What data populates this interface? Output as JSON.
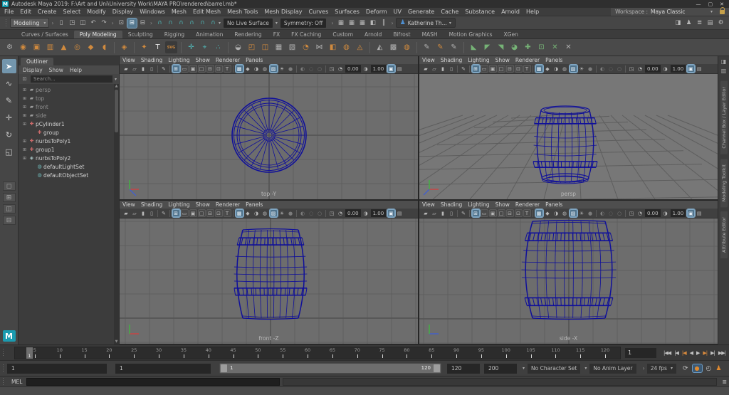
{
  "window": {
    "logo_glyph": "M",
    "title": "Autodesk Maya 2019: F:\\Art and Uni\\University Work\\MAYA PRO\\rendered\\barrel.mb*",
    "controls": {
      "minimize": "—",
      "maximize": "▢",
      "close": "✕"
    }
  },
  "menu_bar": {
    "items": [
      "File",
      "Edit",
      "Create",
      "Select",
      "Modify",
      "Display",
      "Windows",
      "Mesh",
      "Edit Mesh",
      "Mesh Tools",
      "Mesh Display",
      "Curves",
      "Surfaces",
      "Deform",
      "UV",
      "Generate",
      "Cache",
      "Substance",
      "Arnold",
      "Help"
    ],
    "workspace_label": "Workspace :",
    "workspace_value": "Maya Classic"
  },
  "status_line": {
    "mode": "Modeling",
    "file_icons": [
      {
        "name": "new-scene-icon",
        "glyph": "▯"
      },
      {
        "name": "open-scene-icon",
        "glyph": "◳"
      },
      {
        "name": "save-scene-icon",
        "glyph": "◫"
      },
      {
        "name": "undo-icon",
        "glyph": "↶"
      },
      {
        "name": "redo-icon",
        "glyph": "↷"
      }
    ],
    "selection_icons": [
      {
        "name": "select-hierarchy-icon",
        "glyph": "⊡"
      },
      {
        "name": "select-object-icon",
        "glyph": "⊞",
        "active": true
      },
      {
        "name": "select-component-icon",
        "glyph": "⊟"
      }
    ],
    "snap_icons": [
      {
        "name": "snap-grid-icon",
        "glyph": "∩"
      },
      {
        "name": "snap-curve-icon",
        "glyph": "∩"
      },
      {
        "name": "snap-point-icon",
        "glyph": "∩"
      },
      {
        "name": "snap-projected-center-icon",
        "glyph": "∩"
      },
      {
        "name": "snap-view-plane-icon",
        "glyph": "∩"
      },
      {
        "name": "snap-live-surface-icon",
        "glyph": "∩"
      }
    ],
    "live_surface": "No Live Surface",
    "symmetry": "Symmetry: Off",
    "render_icons": [
      {
        "name": "render-frame-icon",
        "glyph": "▦"
      },
      {
        "name": "ipr-render-icon",
        "glyph": "▦"
      },
      {
        "name": "render-settings-icon",
        "glyph": "▦"
      },
      {
        "name": "launch-render-view-icon",
        "glyph": "◧"
      },
      {
        "name": "pause-viewport-icon",
        "glyph": "‖"
      }
    ],
    "user": "Katherine Th...",
    "right_icons": [
      {
        "name": "show-attribute-editor-icon",
        "glyph": "◨"
      },
      {
        "name": "show-tool-settings-icon",
        "glyph": "♟"
      },
      {
        "name": "show-channel-box-icon",
        "glyph": "≣"
      },
      {
        "name": "show-layer-editor-icon",
        "glyph": "▤"
      },
      {
        "name": "show-modeling-toolkit-icon",
        "glyph": "⚙"
      }
    ]
  },
  "shelf": {
    "active_tab": "Poly Modeling",
    "tabs": [
      "Curves / Surfaces",
      "Poly Modeling",
      "Sculpting",
      "Rigging",
      "Animation",
      "Rendering",
      "FX",
      "FX Caching",
      "Custom",
      "Arnold",
      "Bifrost",
      "MASH",
      "Motion Graphics",
      "XGen"
    ],
    "icons": [
      {
        "name": "shelf-gear-icon",
        "glyph": "⚙",
        "color": "#b0b0b0"
      },
      {
        "name": "poly-sphere-icon",
        "glyph": "◉",
        "color": "#d08a3e"
      },
      {
        "name": "poly-cube-icon",
        "glyph": "▣",
        "color": "#d08a3e"
      },
      {
        "name": "poly-cylinder-icon",
        "glyph": "▥",
        "color": "#d08a3e"
      },
      {
        "name": "poly-cone-icon",
        "glyph": "▲",
        "color": "#d08a3e"
      },
      {
        "name": "poly-torus-icon",
        "glyph": "◎",
        "color": "#d08a3e"
      },
      {
        "name": "poly-plane-icon",
        "glyph": "◆",
        "color": "#d08a3e"
      },
      {
        "name": "poly-disc-icon",
        "glyph": "◖",
        "color": "#d08a3e"
      },
      {
        "name": "sep"
      },
      {
        "name": "platonic-solid-icon",
        "glyph": "◈",
        "color": "#d08a3e"
      },
      {
        "name": "sep"
      },
      {
        "name": "create-polygon-icon",
        "glyph": "✦",
        "color": "#d08a3e"
      },
      {
        "name": "type-tool-icon",
        "glyph": "T",
        "color": "#e2e2e2"
      },
      {
        "name": "svg-tool-icon",
        "glyph": "SVG",
        "color": "#d08a3e",
        "small": true
      },
      {
        "name": "sep"
      },
      {
        "name": "construction-plane-icon",
        "glyph": "✛",
        "color": "#52b8b8"
      },
      {
        "name": "locator-icon",
        "glyph": "⌖",
        "color": "#52b8b8"
      },
      {
        "name": "origin-locator-icon",
        "glyph": "∴",
        "color": "#52b8b8"
      },
      {
        "name": "sep"
      },
      {
        "name": "combine-icon",
        "glyph": "◒",
        "color": "#b0b0b0"
      },
      {
        "name": "separate-icon",
        "glyph": "◰",
        "color": "#d08a3e"
      },
      {
        "name": "booleans-icon",
        "glyph": "◫",
        "color": "#d08a3e"
      },
      {
        "name": "smooth-icon",
        "glyph": "▦",
        "color": "#b0b0b0"
      },
      {
        "name": "reduce-icon",
        "glyph": "▧",
        "color": "#b0b0b0"
      },
      {
        "name": "wedge-icon",
        "glyph": "◔",
        "color": "#d08a3e"
      },
      {
        "name": "mirror-icon",
        "glyph": "⋈",
        "color": "#b0b0b0"
      },
      {
        "name": "duplicate-face-icon",
        "glyph": "◧",
        "color": "#d08a3e"
      },
      {
        "name": "remesh-icon",
        "glyph": "◍",
        "color": "#d08a3e"
      },
      {
        "name": "retopologize-icon",
        "glyph": "◬",
        "color": "#d08a3e"
      },
      {
        "name": "sep"
      },
      {
        "name": "sculpt-tool-icon",
        "glyph": "◭",
        "color": "#b0b0b0"
      },
      {
        "name": "lattice-icon",
        "glyph": "▩",
        "color": "#b0b0b0"
      },
      {
        "name": "smooth-mesh-preview-icon",
        "glyph": "◍",
        "color": "#d08a3e"
      },
      {
        "name": "sep"
      },
      {
        "name": "cv-curve-icon",
        "glyph": "✎",
        "color": "#b0b0b0"
      },
      {
        "name": "ep-curve-icon",
        "glyph": "✎",
        "color": "#d08a3e"
      },
      {
        "name": "pencil-curve-icon",
        "glyph": "✎",
        "color": "#b0b0b0"
      },
      {
        "name": "sep"
      },
      {
        "name": "bevel-icon",
        "glyph": "◣",
        "color": "#76b376"
      },
      {
        "name": "bridge-icon",
        "glyph": "◤",
        "color": "#76b376"
      },
      {
        "name": "extrude-icon",
        "glyph": "◥",
        "color": "#76b376"
      },
      {
        "name": "quad-draw-icon",
        "glyph": "◕",
        "color": "#76b376"
      },
      {
        "name": "multi-cut-icon",
        "glyph": "✚",
        "color": "#76b376"
      },
      {
        "name": "target-weld-icon",
        "glyph": "⊡",
        "color": "#76b376"
      },
      {
        "name": "symmetrize-icon",
        "glyph": "✕",
        "color": "#76b376"
      },
      {
        "name": "delete-edge-icon",
        "glyph": "✕",
        "color": "#b0b0b0"
      }
    ]
  },
  "toolbox": {
    "tools": [
      {
        "name": "select-tool",
        "glyph": "➤",
        "active": true
      },
      {
        "name": "lasso-tool",
        "glyph": "∿"
      },
      {
        "name": "paint-select-tool",
        "glyph": "✎"
      },
      {
        "name": "move-tool",
        "glyph": "✛"
      },
      {
        "name": "rotate-tool",
        "glyph": "↻"
      },
      {
        "name": "scale-tool",
        "glyph": "◱"
      }
    ],
    "layouts": [
      {
        "name": "layout-single-pane",
        "glyph": "◻"
      },
      {
        "name": "layout-four-pane",
        "glyph": "⊞"
      },
      {
        "name": "layout-persp-outliner",
        "glyph": "◫"
      },
      {
        "name": "layout-split-pane",
        "glyph": "⊟"
      }
    ],
    "maya_logo": "M"
  },
  "outliner": {
    "tab": "Outliner",
    "menus": [
      "Display",
      "Show",
      "Help"
    ],
    "search_placeholder": "Search...",
    "items": [
      {
        "label": "persp",
        "icon": "camera",
        "expand": true,
        "dim": true
      },
      {
        "label": "top",
        "icon": "camera",
        "expand": true,
        "dim": true
      },
      {
        "label": "front",
        "icon": "camera",
        "expand": true,
        "dim": true
      },
      {
        "label": "side",
        "icon": "camera",
        "expand": true,
        "dim": true
      },
      {
        "label": "pCylinder1",
        "icon": "transform",
        "expand": true
      },
      {
        "label": "group",
        "icon": "transform",
        "indent": 1
      },
      {
        "label": "nurbsToPoly1",
        "icon": "transform",
        "expand": true
      },
      {
        "label": "group1",
        "icon": "transform",
        "expand": true
      },
      {
        "label": "nurbsToPoly2",
        "icon": "mesh",
        "expand": true
      },
      {
        "label": "defaultLightSet",
        "icon": "set",
        "indent": 1
      },
      {
        "label": "defaultObjectSet",
        "icon": "set",
        "indent": 1
      }
    ]
  },
  "viewport_menus": [
    "View",
    "Shading",
    "Lighting",
    "Show",
    "Renderer",
    "Panels"
  ],
  "viewport_icons": [
    {
      "name": "select-camera-icon",
      "glyph": "▰"
    },
    {
      "name": "lock-camera-icon",
      "glyph": "▱"
    },
    {
      "name": "camera-attributes-icon",
      "glyph": "▮"
    },
    {
      "name": "bookmarks-icon",
      "glyph": "▯"
    },
    {
      "name": "sep"
    },
    {
      "name": "grease-pencil-icon",
      "glyph": "✎"
    },
    {
      "name": "sep"
    },
    {
      "name": "four-view-layout-icon",
      "glyph": "⊞",
      "boxed": true,
      "active": true
    },
    {
      "name": "single-view-layout-icon",
      "glyph": "▭",
      "boxed": true
    },
    {
      "name": "shaded-display-icon",
      "glyph": "▣",
      "boxed": true
    },
    {
      "name": "textured-display-icon",
      "glyph": "□",
      "boxed": true
    },
    {
      "name": "split-view-icon",
      "glyph": "⊟",
      "boxed": true
    },
    {
      "name": "outliner-split-icon",
      "glyph": "⊡",
      "boxed": true
    },
    {
      "name": "hypershade-view-icon",
      "glyph": "T",
      "boxed": true
    },
    {
      "name": "sep"
    },
    {
      "name": "wireframe-mode-icon",
      "glyph": "▩",
      "boxed": true,
      "active": true
    },
    {
      "name": "shaded-mode-icon",
      "glyph": "◆"
    },
    {
      "name": "material-mode-icon",
      "glyph": "◑"
    },
    {
      "name": "textured-mode-icon",
      "glyph": "◍"
    },
    {
      "name": "wireframe-on-shaded-icon",
      "glyph": "▨",
      "boxed": true,
      "active": true
    },
    {
      "name": "use-all-lights-icon",
      "glyph": "☀"
    },
    {
      "name": "shadows-icon",
      "glyph": "●",
      "dim": true
    },
    {
      "name": "sep"
    },
    {
      "name": "ambient-occlusion-icon",
      "glyph": "◐",
      "dim": true
    },
    {
      "name": "motion-blur-icon",
      "glyph": "◌",
      "dim": true
    },
    {
      "name": "anti-aliasing-icon",
      "glyph": "○",
      "dim": true
    },
    {
      "name": "sep"
    },
    {
      "name": "isolate-select-icon",
      "glyph": "◳"
    },
    {
      "name": "exposure-icon",
      "glyph": "◔"
    },
    {
      "name": "exposure-field",
      "field": "0.00"
    },
    {
      "name": "gamma-icon",
      "glyph": "◑"
    },
    {
      "name": "gamma-field",
      "field": "1.00"
    },
    {
      "name": "view-transform-icon",
      "glyph": "▣",
      "boxed": true,
      "active": true
    },
    {
      "name": "snapshot-icon",
      "glyph": "▤"
    }
  ],
  "viewports": [
    {
      "id": "top",
      "label": "top -Y",
      "type": "ortho-top"
    },
    {
      "id": "persp",
      "label": "persp",
      "type": "persp"
    },
    {
      "id": "front",
      "label": "front -Z",
      "type": "ortho-front"
    },
    {
      "id": "side",
      "label": "side -X",
      "type": "ortho-side"
    }
  ],
  "right_panel_tabs": [
    "Channel Box / Layer Editor",
    "Modeling Toolkit",
    "Attribute Editor"
  ],
  "timeline": {
    "ticks": [
      5,
      10,
      15,
      20,
      25,
      30,
      35,
      40,
      45,
      50,
      55,
      60,
      65,
      70,
      75,
      80,
      85,
      90,
      95,
      100,
      105,
      110,
      115,
      120
    ],
    "range_min": 1,
    "range_max": 123,
    "current_frame": "1",
    "current_time_field": "1",
    "playback": [
      {
        "name": "go-to-start-button",
        "glyph": "|◀◀"
      },
      {
        "name": "step-back-frame-button",
        "glyph": "|◀"
      },
      {
        "name": "step-back-key-button",
        "glyph": "|◀",
        "accent": true
      },
      {
        "name": "play-backwards-button",
        "glyph": "◀"
      },
      {
        "name": "play-forwards-button",
        "glyph": "▶"
      },
      {
        "name": "step-forward-key-button",
        "glyph": "▶|",
        "accent": true
      },
      {
        "name": "step-forward-frame-button",
        "glyph": "▶|"
      },
      {
        "name": "go-to-end-button",
        "glyph": "▶▶|"
      }
    ]
  },
  "range_slider": {
    "anim_start_field": "1",
    "playback_start_field": "1",
    "bar_start_label": "1",
    "bar_end_label": "120",
    "playback_end_field": "120",
    "anim_end_field": "200",
    "character_set": "No Character Set",
    "anim_layer": "No Anim Layer",
    "fps": "24 fps",
    "icons": [
      {
        "name": "playback-loop-icon",
        "glyph": "⟳"
      },
      {
        "name": "auto-keyframe-icon",
        "glyph": "●",
        "key": true
      },
      {
        "name": "animation-prefs-icon",
        "glyph": "◴"
      },
      {
        "name": "character-controls-icon",
        "glyph": "♟",
        "orange": true
      }
    ]
  },
  "command_line": {
    "label": "MEL"
  },
  "colors": {
    "wireframe": "#10109a",
    "ortho_bg": "#6d6d6d",
    "persp_bg": "#777777",
    "grid_line": "#5e5e5e",
    "grid_axis": "#525252",
    "axis_x": "#c84545",
    "axis_y": "#45b045",
    "axis_z": "#4560c8"
  }
}
